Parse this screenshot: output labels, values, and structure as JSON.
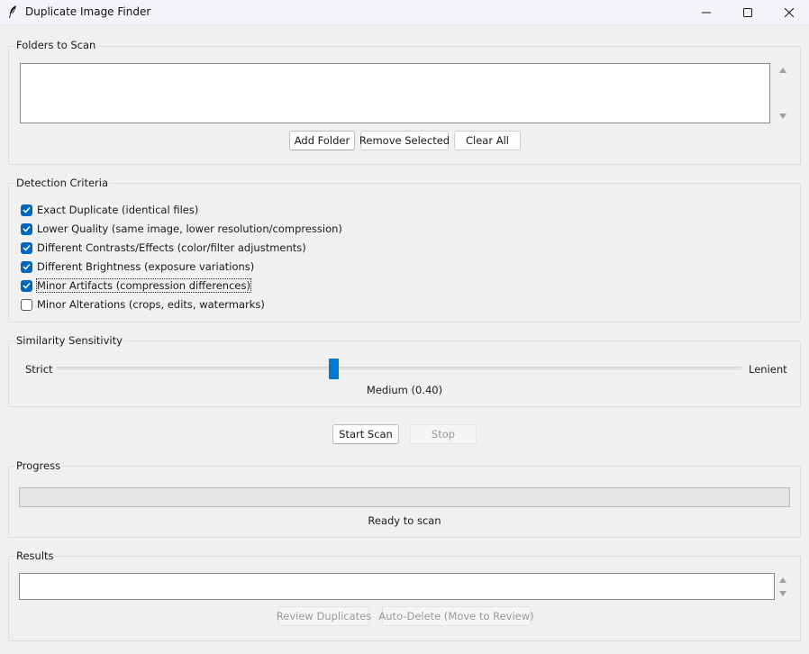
{
  "window": {
    "title": "Duplicate Image Finder",
    "icon": "feather-icon",
    "controls": [
      "minimize-icon",
      "maximize-icon",
      "close-icon"
    ]
  },
  "folders": {
    "label": "Folders to Scan",
    "items": [],
    "buttons": {
      "add": "Add Folder",
      "remove": "Remove Selected",
      "clear": "Clear All"
    }
  },
  "criteria": {
    "label": "Detection Criteria",
    "options": [
      {
        "label": "Exact Duplicate (identical files)",
        "checked": true
      },
      {
        "label": "Lower Quality (same image, lower resolution/compression)",
        "checked": true
      },
      {
        "label": "Different Contrasts/Effects (color/filter adjustments)",
        "checked": true
      },
      {
        "label": "Different Brightness (exposure variations)",
        "checked": true
      },
      {
        "label": "Minor Artifacts (compression differences)",
        "checked": true,
        "focused": true
      },
      {
        "label": "Minor Alterations (crops, edits, watermarks)",
        "checked": false
      }
    ]
  },
  "sensitivity": {
    "label": "Similarity Sensitivity",
    "min_label": "Strict",
    "max_label": "Lenient",
    "value_text": "Medium (0.40)",
    "value": 0.4
  },
  "scan": {
    "start": "Start Scan",
    "stop": "Stop"
  },
  "progress": {
    "label": "Progress",
    "status": "Ready to scan",
    "value": 0
  },
  "results": {
    "label": "Results",
    "items": [],
    "buttons": {
      "review": "Review Duplicates",
      "auto_delete": "Auto-Delete (Move to Review)"
    }
  },
  "colors": {
    "accent": "#0067c0",
    "slider_thumb": "#0078d7",
    "window_bg": "#f0f0f0"
  }
}
